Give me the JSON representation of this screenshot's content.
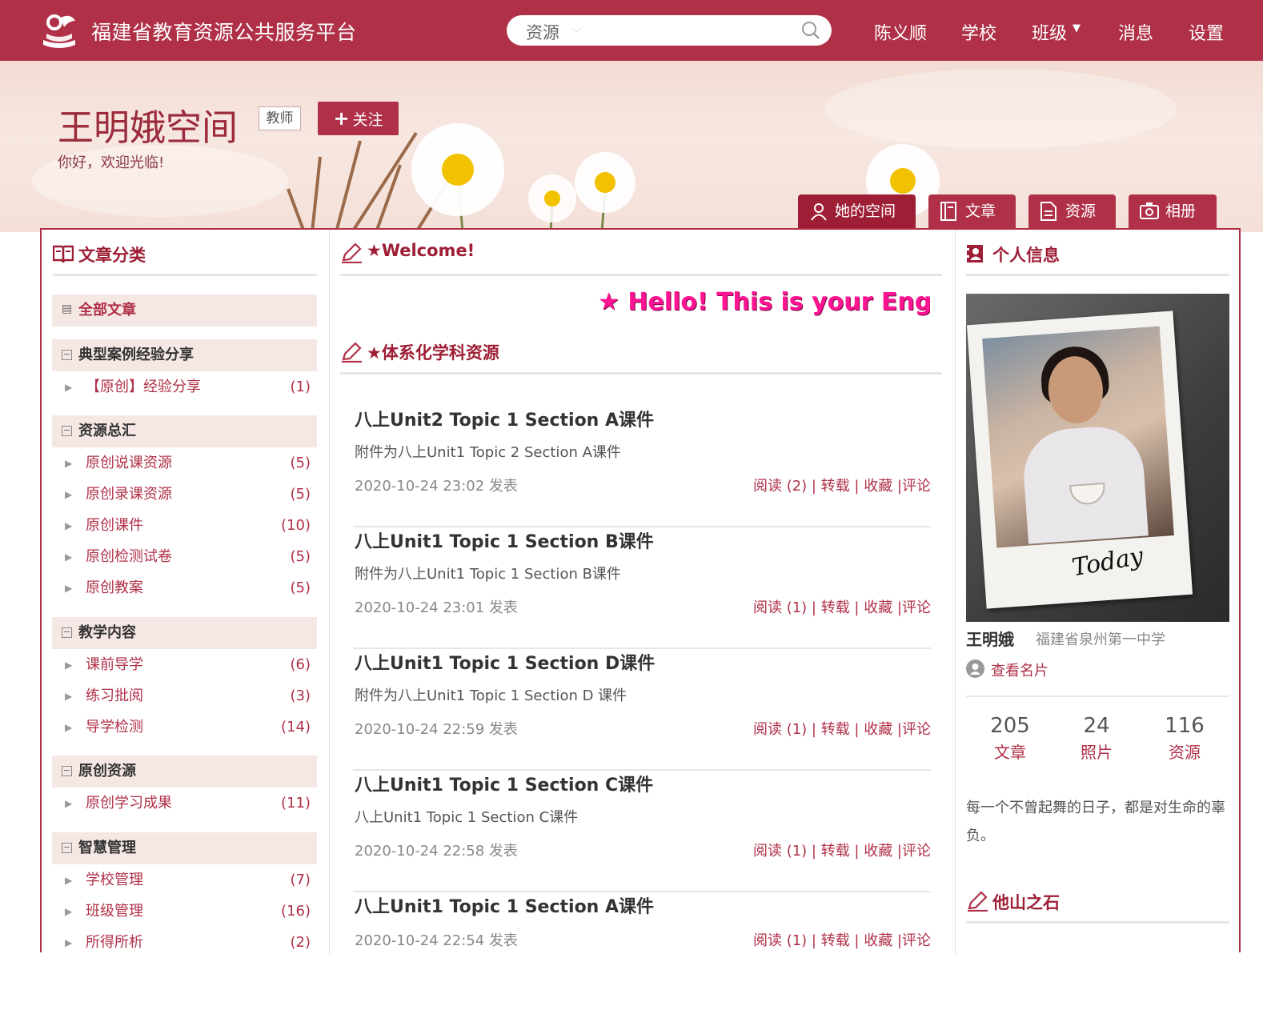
{
  "header": {
    "site_title": "福建省教育资源公共服务平台",
    "search_scope": "资源",
    "nav": {
      "user": "陈义顺",
      "school": "学校",
      "class": "班级",
      "messages": "消息",
      "settings": "设置"
    }
  },
  "banner": {
    "space_title": "王明娥空间",
    "role": "教师",
    "follow_label": "关注",
    "welcome": "你好，欢迎光临!"
  },
  "tabs": [
    {
      "label": "她的空间",
      "icon": "user-icon",
      "active": true
    },
    {
      "label": "文章",
      "icon": "notebook-icon",
      "active": false
    },
    {
      "label": "资源",
      "icon": "document-icon",
      "active": false
    },
    {
      "label": "相册",
      "icon": "camera-icon",
      "active": false
    }
  ],
  "left": {
    "title": "文章分类",
    "all_articles": "全部文章",
    "groups": [
      {
        "name": "典型案例经验分享",
        "items": [
          {
            "label": "【原创】经验分享",
            "count": "(1)"
          }
        ]
      },
      {
        "name": "资源总汇",
        "items": [
          {
            "label": "原创说课资源",
            "count": "(5)"
          },
          {
            "label": "原创录课资源",
            "count": "(5)"
          },
          {
            "label": "原创课件",
            "count": "(10)"
          },
          {
            "label": "原创检测试卷",
            "count": "(5)"
          },
          {
            "label": "原创教案",
            "count": "(5)"
          }
        ]
      },
      {
        "name": "教学内容",
        "items": [
          {
            "label": "课前导学",
            "count": "(6)"
          },
          {
            "label": "练习批阅",
            "count": "(3)"
          },
          {
            "label": "导学检测",
            "count": "(14)"
          }
        ]
      },
      {
        "name": "原创资源",
        "items": [
          {
            "label": "原创学习成果",
            "count": "(11)"
          }
        ]
      },
      {
        "name": "智慧管理",
        "items": [
          {
            "label": "学校管理",
            "count": "(7)"
          },
          {
            "label": "班级管理",
            "count": "(16)"
          },
          {
            "label": "所得所析",
            "count": "(2)"
          }
        ]
      }
    ]
  },
  "middle": {
    "welcome_title": "★Welcome!",
    "marquee": "★ Hello!  This is your English",
    "resources_title": "★体系化学科资源",
    "posts": [
      {
        "title": "八上Unit2 Topic 1 Section A课件",
        "desc": "附件为八上Unit1 Topic 2 Section A课件",
        "time": "2020-10-24 23:02 发表",
        "actions": "阅读 (2) | 转载 | 收藏 |评论"
      },
      {
        "title": "八上Unit1 Topic 1 Section B课件",
        "desc": "附件为八上Unit1 Topic 1 Section B课件",
        "time": "2020-10-24 23:01 发表",
        "actions": "阅读 (1) | 转载 | 收藏 |评论"
      },
      {
        "title": "八上Unit1 Topic 1 Section D课件",
        "desc": "附件为八上Unit1 Topic 1 Section D 课件",
        "time": "2020-10-24 22:59 发表",
        "actions": "阅读 (1) | 转载 | 收藏 |评论"
      },
      {
        "title": "八上Unit1 Topic 1 Section C课件",
        "desc": "八上Unit1 Topic 1 Section C课件",
        "time": "2020-10-24 22:58 发表",
        "actions": "阅读 (1) | 转载 | 收藏 |评论"
      },
      {
        "title": "八上Unit1 Topic 1 Section A课件",
        "desc": "",
        "time": "2020-10-24 22:54 发表",
        "actions": "阅读 (1) | 转载 | 收藏 |评论"
      }
    ]
  },
  "right": {
    "title": "个人信息",
    "photo_caption": "Today",
    "name": "王明娥",
    "school": "福建省泉州第一中学",
    "card_link": "查看名片",
    "stats": [
      {
        "num": "205",
        "label": "文章"
      },
      {
        "num": "24",
        "label": "照片"
      },
      {
        "num": "116",
        "label": "资源"
      }
    ],
    "motto": "每一个不曾起舞的日子，都是对生命的辜负。",
    "title2": "他山之石"
  },
  "colors": {
    "brand": "#b03048",
    "brand_dark": "#9e1e35",
    "accent_pink": "#ff1493"
  }
}
